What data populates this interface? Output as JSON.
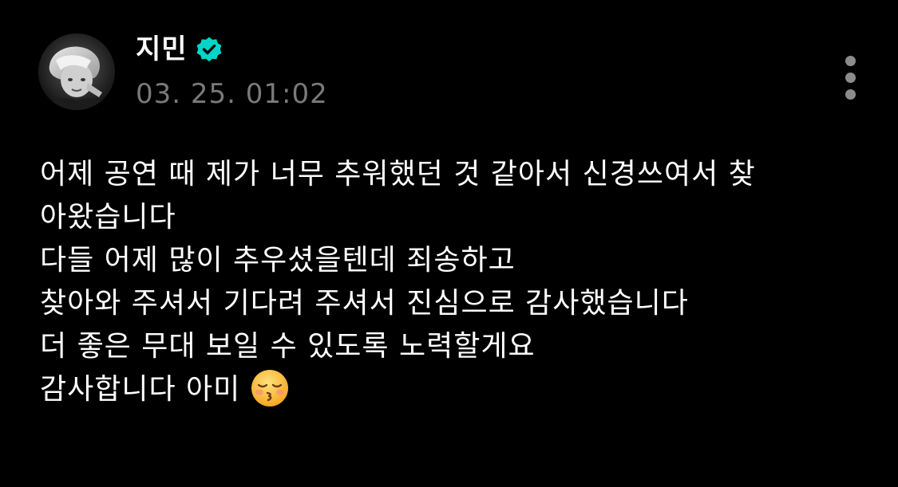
{
  "post": {
    "author_name": "지민",
    "verified": true,
    "timestamp": "03. 25. 01:02",
    "body_lines": [
      "어제 공연 때 제가 너무 추워했던 것 같아서 신경쓰여서 찾",
      "아왔습니다",
      "다들 어제 많이 추우셨을텐데 죄송하고",
      "찾아와 주셔서 기다려 주셔서 진심으로 감사했습니다",
      "더 좋은 무대 보일 수 있도록 노력할게요",
      "감사합니다 아미"
    ],
    "emoji": "kissing-face-with-closed-eyes"
  },
  "colors": {
    "background": "#000000",
    "text": "#ffffff",
    "timestamp": "#7a7a7a",
    "verified_badge": "#07d4c8",
    "more_dots": "#8c8c8c"
  },
  "icons": {
    "verified": "verified-badge-icon",
    "more": "more-vertical-icon",
    "avatar": "profile-photo"
  }
}
